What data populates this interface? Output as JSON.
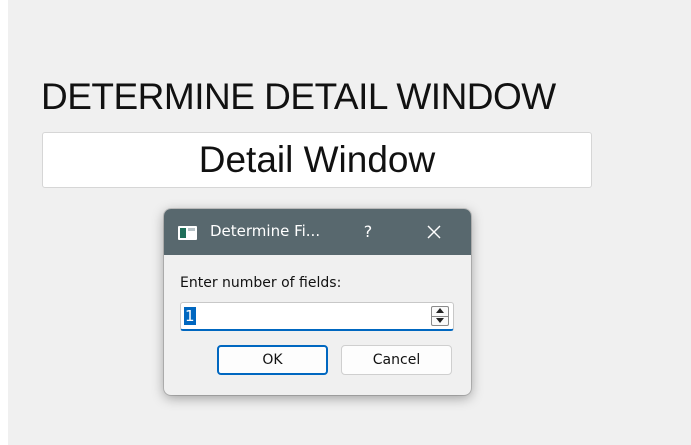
{
  "main": {
    "heading": "DETERMINE DETAIL WINDOW",
    "detail_field_text": "Detail Window"
  },
  "dialog": {
    "title": "Determine Fi...",
    "help_label": "?",
    "prompt": "Enter number of fields:",
    "spin_value": "1",
    "ok_label": "OK",
    "cancel_label": "Cancel",
    "icons": {
      "app": "window-app-icon",
      "close": "close-icon",
      "spin_up": "chevron-up-icon",
      "spin_down": "chevron-down-icon"
    }
  },
  "colors": {
    "titlebar": "#58686e",
    "accent": "#0067c0",
    "window_bg": "#f0f0f0"
  }
}
